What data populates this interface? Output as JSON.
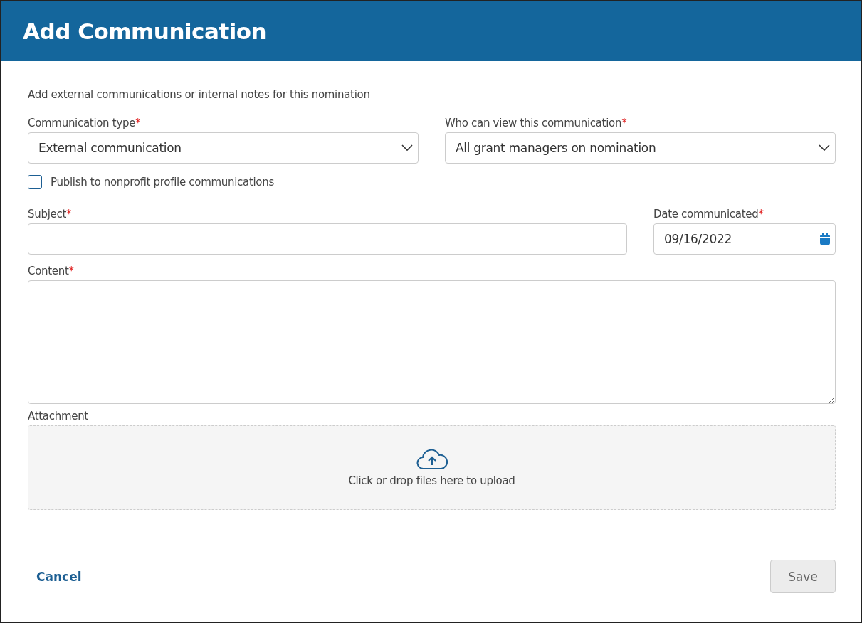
{
  "dialog": {
    "title": "Add Communication"
  },
  "intro": "Add external communications or internal notes for this nomination",
  "communication_type": {
    "label": "Communication type",
    "required_mark": "*",
    "value": "External communication"
  },
  "visibility": {
    "label": "Who can view this communication",
    "required_mark": "*",
    "value": "All grant managers on nomination"
  },
  "publish": {
    "label": "Publish to nonprofit profile communications",
    "checked": false
  },
  "subject": {
    "label": "Subject",
    "required_mark": "*"
  },
  "date": {
    "label": "Date communicated",
    "required_mark": "*",
    "value": "09/16/2022"
  },
  "content": {
    "label": "Content",
    "required_mark": "*"
  },
  "attachment": {
    "label": "Attachment",
    "prompt": "Click or drop files here to upload"
  },
  "buttons": {
    "cancel": {
      "label": "Cancel"
    },
    "save": {
      "label": "Save",
      "disabled": true
    }
  }
}
